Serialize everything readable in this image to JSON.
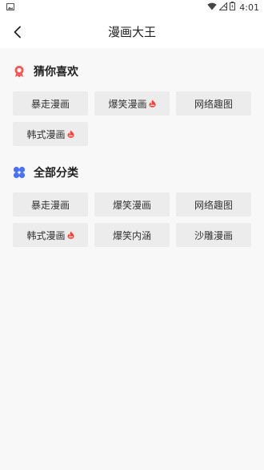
{
  "status_bar": {
    "time": "4:01"
  },
  "header": {
    "title": "漫画大王"
  },
  "sections": [
    {
      "title": "猜你喜欢",
      "tags": [
        {
          "label": "暴走漫画",
          "hot": false
        },
        {
          "label": "爆笑漫画",
          "hot": true
        },
        {
          "label": "网络趣图",
          "hot": false
        },
        {
          "label": "韩式漫画",
          "hot": true
        }
      ]
    },
    {
      "title": "全部分类",
      "tags": [
        {
          "label": "暴走漫画",
          "hot": false
        },
        {
          "label": "爆笑漫画",
          "hot": false
        },
        {
          "label": "网络趣图",
          "hot": false
        },
        {
          "label": "韩式漫画",
          "hot": true
        },
        {
          "label": "爆笑内涵",
          "hot": false
        },
        {
          "label": "沙雕漫画",
          "hot": false
        }
      ]
    }
  ],
  "icons": {
    "favorite_icon": "ribbon-badge-icon",
    "category_icon": "four-petal-icon",
    "hot_icon": "fire-icon"
  },
  "colors": {
    "favorite_icon": "#f25a5a",
    "category_icon": "#4a72f2",
    "hot_icon": "#f0453a",
    "tag_bg": "#ececec"
  }
}
